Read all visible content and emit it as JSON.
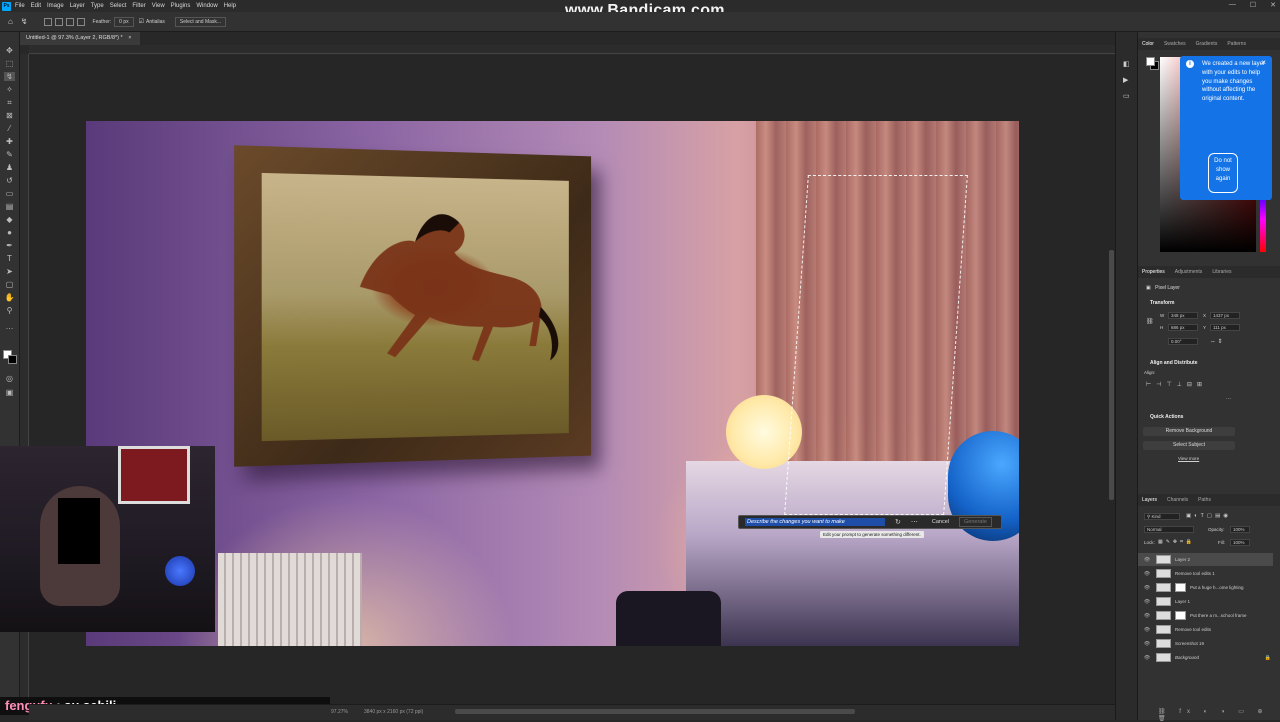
{
  "app": {
    "logo": "Ps",
    "menu": [
      "File",
      "Edit",
      "Image",
      "Layer",
      "Type",
      "Select",
      "Filter",
      "View",
      "Plugins",
      "Window",
      "Help"
    ]
  },
  "watermark": "www.Bandicam.com",
  "options_bar": {
    "feather_label": "Feather:",
    "feather_value": "0 px",
    "antialias_label": "Antialias",
    "select_mask_label": "Select and Mask..."
  },
  "document": {
    "tab_title": "Untitled-1 @ 97.3% (Layer 2, RGB/8*) *",
    "tab_close": "×"
  },
  "generative_bar": {
    "prompt_value": "Describe the changes you want to make",
    "cancel_label": "Cancel",
    "generate_label": "Generate",
    "more_icon": "⋯",
    "hint": "Edit your prompt to generate something different."
  },
  "stream": {
    "chat_user": "fengufu",
    "chat_message": " : su sebili"
  },
  "panels": {
    "color_tabs": [
      "Color",
      "Swatches",
      "Gradients",
      "Patterns"
    ],
    "tooltip_text": "We created a new layer with your edits to help you make changes without affecting the original content.",
    "tooltip_button": "Do not show again",
    "tooltip_close": "×",
    "properties_tabs": [
      "Properties",
      "Adjustments",
      "Libraries"
    ],
    "pixel_layer_label": "Pixel Layer",
    "transform_label": "Transform",
    "w_label": "W",
    "w_value": "348 px",
    "h_label": "H",
    "h_value": "686 px",
    "x_label": "X",
    "x_value": "1437 px",
    "y_label": "Y",
    "y_value": "111 px",
    "angle_value": "0.00°",
    "align_label": "Align and Distribute",
    "align_sub": "Align:",
    "more": "···",
    "quick_actions_label": "Quick Actions",
    "remove_bg": "Remove Background",
    "select_subject": "Select Subject",
    "view_more": "View more",
    "layers_tabs": [
      "Layers",
      "Channels",
      "Paths"
    ],
    "kind_label": "Kind",
    "blend_mode": "Normal",
    "opacity_label": "Opacity:",
    "opacity_value": "100%",
    "lock_label": "Lock:",
    "fill_label": "Fill:",
    "fill_value": "100%"
  },
  "layers": [
    {
      "name": "Layer 2",
      "selected": true,
      "mask": false
    },
    {
      "name": "Remove tool edits 1",
      "selected": false,
      "mask": false
    },
    {
      "name": "Put a huge h...ome lighting",
      "selected": false,
      "mask": true
    },
    {
      "name": "Layer 1",
      "selected": false,
      "mask": false
    },
    {
      "name": "Put there a m...school frame",
      "selected": false,
      "mask": true
    },
    {
      "name": "Remove tool edits",
      "selected": false,
      "mask": false
    },
    {
      "name": "Screenshot 19",
      "selected": false,
      "mask": false
    },
    {
      "name": "Background",
      "selected": false,
      "mask": false,
      "locked": true
    }
  ],
  "status": {
    "zoom": "97.27%",
    "doc_size": "3840 px x 2160 px (72 ppi)"
  },
  "colors": {
    "accent": "#1473e6",
    "chat_user": "#ff8fb8"
  }
}
